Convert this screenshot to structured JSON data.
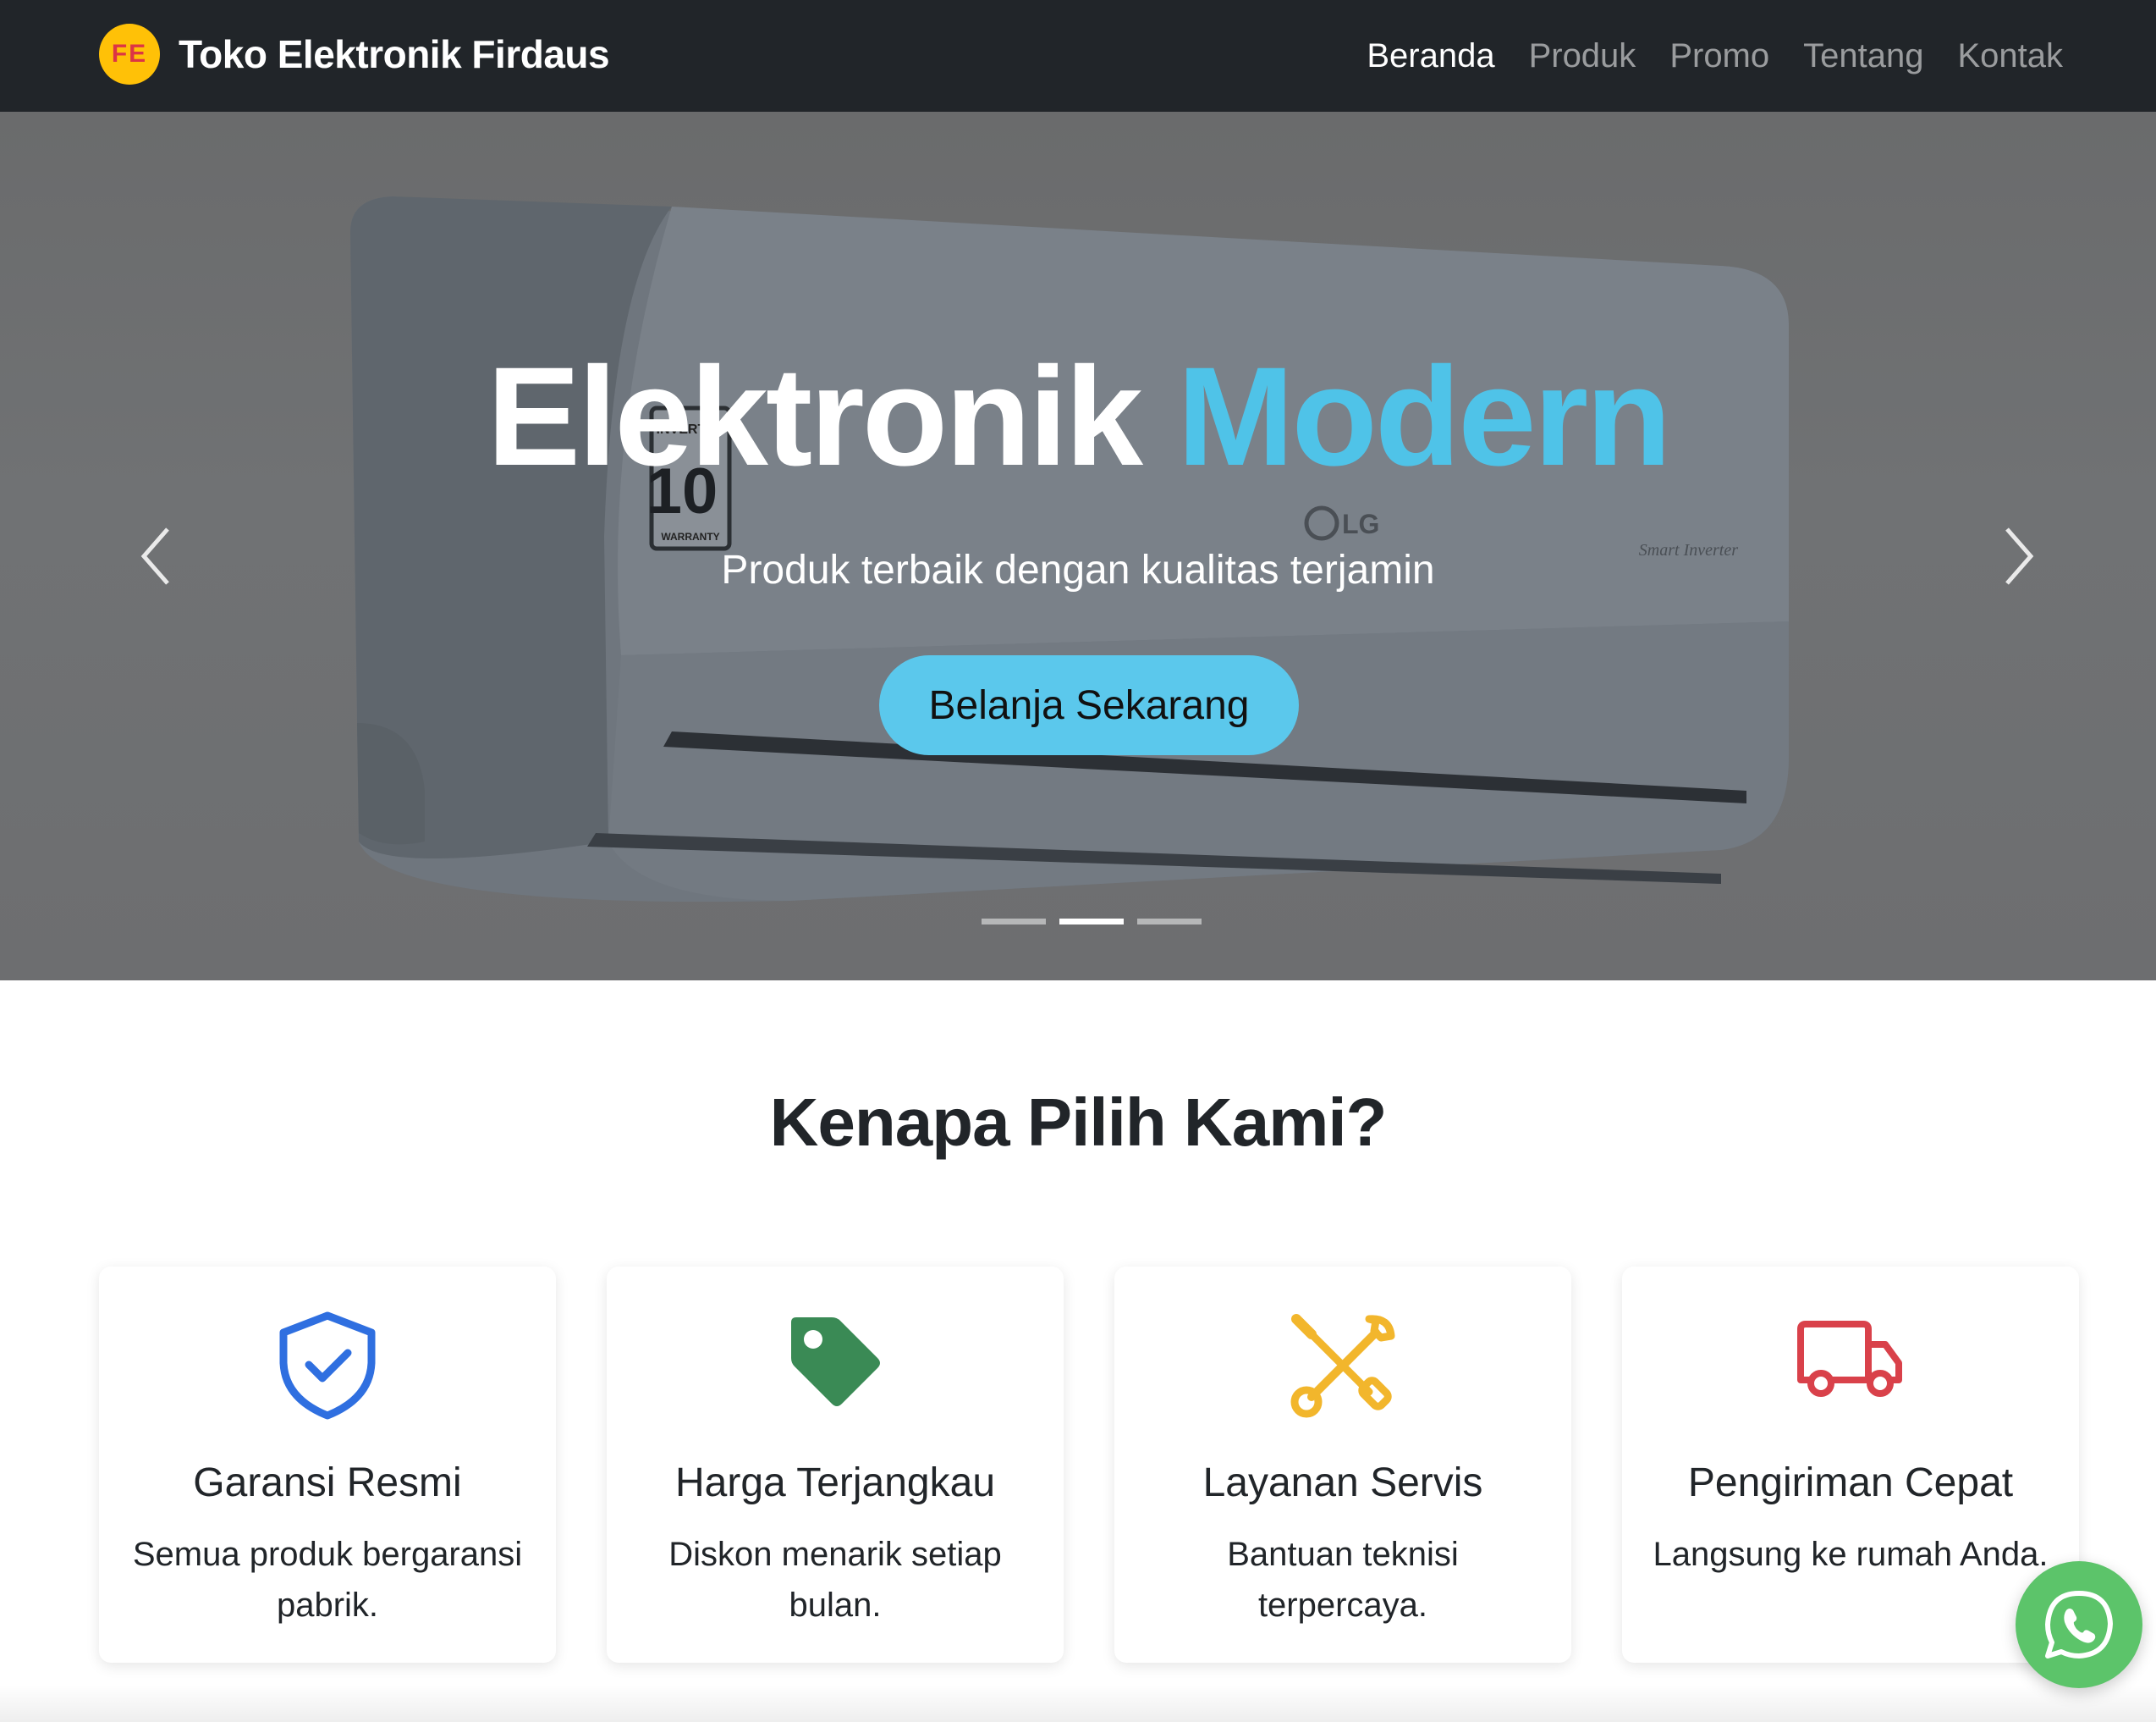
{
  "navbar": {
    "logo_text": "FE",
    "brand_name": "Toko Elektronik Firdaus",
    "links": [
      {
        "label": "Beranda",
        "active": true
      },
      {
        "label": "Produk",
        "active": false
      },
      {
        "label": "Promo",
        "active": false
      },
      {
        "label": "Tentang",
        "active": false
      },
      {
        "label": "Kontak",
        "active": false
      }
    ]
  },
  "hero": {
    "title_main": "Elektronik",
    "title_accent": "Modern",
    "subtitle": "Produk terbaik dengan kualitas terjamin",
    "cta_label": "Belanja Sekarang",
    "image_labels": {
      "badge_top": "INVERTER",
      "badge_number": "10",
      "badge_bottom": "WARRANTY",
      "brand": "LG",
      "model_text": "Smart Inverter"
    },
    "prev_icon": "chevron-left-icon",
    "next_icon": "chevron-right-icon",
    "indicators": [
      {
        "active": false
      },
      {
        "active": true
      },
      {
        "active": false
      }
    ]
  },
  "features": {
    "title": "Kenapa Pilih Kami?",
    "cards": [
      {
        "icon": "shield-check-icon",
        "icon_color": "#2f6fe0",
        "title": "Garansi Resmi",
        "text": "Semua produk bergaransi pabrik."
      },
      {
        "icon": "tag-icon",
        "icon_color": "#3a8a55",
        "title": "Harga Terjangkau",
        "text": "Diskon menarik setiap bulan."
      },
      {
        "icon": "tools-icon",
        "icon_color": "#f2b62c",
        "title": "Layanan Servis",
        "text": "Bantuan teknisi terpercaya."
      },
      {
        "icon": "truck-icon",
        "icon_color": "#d9414a",
        "title": "Pengiriman Cepat",
        "text": "Langsung ke rumah Anda."
      }
    ]
  },
  "whatsapp": {
    "icon": "whatsapp-icon",
    "color": "#5cc46a"
  },
  "colors": {
    "navbar_bg": "#212529",
    "accent": "#4fc3e8",
    "brand_logo_bg": "#ffc107"
  }
}
